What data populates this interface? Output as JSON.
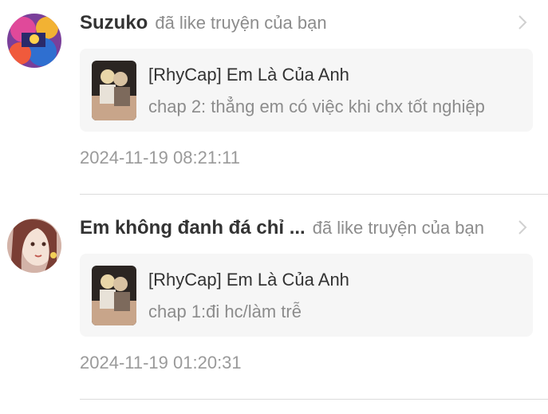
{
  "notifications": [
    {
      "username": "Suzuko",
      "action": "đã like truyện của bạn",
      "story_title": "[RhyCap] Em Là Của Anh",
      "chapter": "chap 2: thẳng em có việc khi chx tốt nghiệp",
      "time": "2024-11-19 08:21:11",
      "avatar_icon": "user-avatar-icon",
      "cover_icon": "story-cover-icon"
    },
    {
      "username": "Em không đanh đá chỉ ...",
      "action": "đã like truyện của bạn",
      "story_title": "[RhyCap] Em Là Của Anh",
      "chapter": "chap 1:đi hc/làm trễ",
      "time": "2024-11-19 01:20:31",
      "avatar_icon": "user-avatar-icon",
      "cover_icon": "story-cover-icon"
    }
  ],
  "colors": {
    "username": "#333333",
    "secondary_text": "#8c8c8c",
    "card_background": "#f6f6f6",
    "divider": "#dcdcdc"
  }
}
